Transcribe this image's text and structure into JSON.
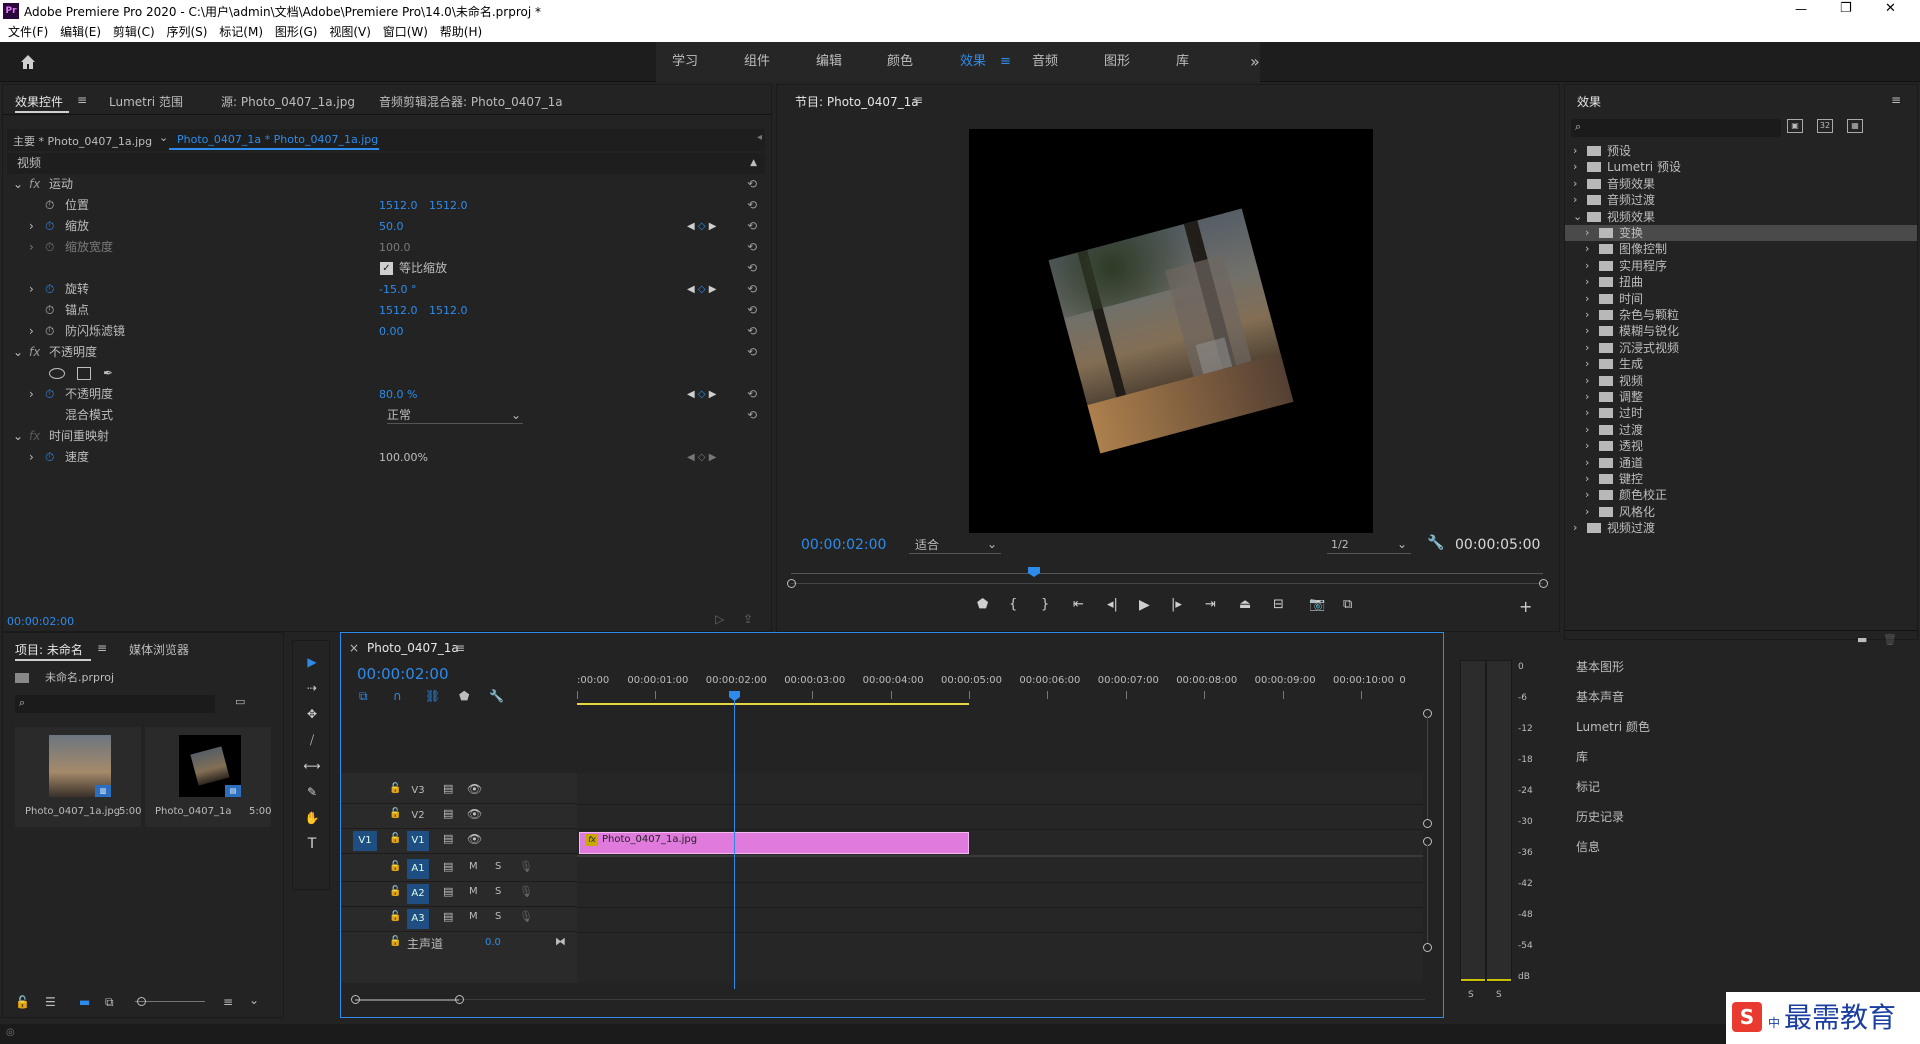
{
  "app": {
    "icon": "Pr",
    "title": "Adobe Premiere Pro 2020 - C:\\用户\\admin\\文档\\Adobe\\Premiere Pro\\14.0\\未命名.prproj *",
    "win_controls": [
      "—",
      "❐",
      "✕"
    ]
  },
  "menu": [
    "文件(F)",
    "编辑(E)",
    "剪辑(C)",
    "序列(S)",
    "标记(M)",
    "图形(G)",
    "视图(V)",
    "窗口(W)",
    "帮助(H)"
  ],
  "workspaces": {
    "items": [
      "学习",
      "组件",
      "编辑",
      "颜色",
      "效果",
      "音频",
      "图形",
      "库"
    ],
    "active": "效果",
    "menu_icon": "≡",
    "more": "»",
    "active_color": "#2d8ceb"
  },
  "effect_controls": {
    "tabs": [
      "效果控件",
      "Lumetri 范围",
      "源: Photo_0407_1a.jpg",
      "音频剪辑混合器: Photo_0407_1a"
    ],
    "tab_menu": "≡",
    "master": "主要 * Photo_0407_1a.jpg",
    "clip": "Photo_0407_1a * Photo_0407_1a.jpg",
    "section": "视频",
    "motion": "运动",
    "position_label": "位置",
    "position_x": "1512.0",
    "position_y": "1512.0",
    "scale_label": "缩放",
    "scale_value": "50.0",
    "scale_width_label": "缩放宽度",
    "scale_width_value": "100.0",
    "uniform_label": "等比缩放",
    "rotation_label": "旋转",
    "rotation_value": "-15.0 °",
    "anchor_label": "锚点",
    "anchor_x": "1512.0",
    "anchor_y": "1512.0",
    "flicker_label": "防闪烁滤镜",
    "flicker_value": "0.00",
    "opacity_group": "不透明度",
    "opacity_label": "不透明度",
    "opacity_value": "80.0 %",
    "blend_label": "混合模式",
    "blend_value": "正常",
    "time_remap": "时间重映射",
    "speed_label": "速度",
    "speed_value": "100.00%",
    "timecode": "00:00:02:00",
    "fx": "fx"
  },
  "program": {
    "title": "节目: Photo_0407_1a",
    "menu": "≡",
    "timecode": "00:00:02:00",
    "fit": "适合",
    "resolution": "1/2",
    "duration": "00:00:05:00"
  },
  "effects_panel": {
    "title": "效果",
    "menu": "≡",
    "tree": [
      {
        "label": "预设",
        "level": 0,
        "open": false
      },
      {
        "label": "Lumetri 预设",
        "level": 0,
        "open": false
      },
      {
        "label": "音频效果",
        "level": 0,
        "open": false
      },
      {
        "label": "音频过渡",
        "level": 0,
        "open": false
      },
      {
        "label": "视频效果",
        "level": 0,
        "open": true
      },
      {
        "label": "变换",
        "level": 1,
        "open": false,
        "selected": true
      },
      {
        "label": "图像控制",
        "level": 1,
        "open": false
      },
      {
        "label": "实用程序",
        "level": 1,
        "open": false
      },
      {
        "label": "扭曲",
        "level": 1,
        "open": false
      },
      {
        "label": "时间",
        "level": 1,
        "open": false
      },
      {
        "label": "杂色与颗粒",
        "level": 1,
        "open": false
      },
      {
        "label": "模糊与锐化",
        "level": 1,
        "open": false
      },
      {
        "label": "沉浸式视频",
        "level": 1,
        "open": false
      },
      {
        "label": "生成",
        "level": 1,
        "open": false
      },
      {
        "label": "视频",
        "level": 1,
        "open": false
      },
      {
        "label": "调整",
        "level": 1,
        "open": false
      },
      {
        "label": "过时",
        "level": 1,
        "open": false
      },
      {
        "label": "过渡",
        "level": 1,
        "open": false
      },
      {
        "label": "透视",
        "level": 1,
        "open": false
      },
      {
        "label": "通道",
        "level": 1,
        "open": false
      },
      {
        "label": "键控",
        "level": 1,
        "open": false
      },
      {
        "label": "颜色校正",
        "level": 1,
        "open": false
      },
      {
        "label": "风格化",
        "level": 1,
        "open": false
      },
      {
        "label": "视频过渡",
        "level": 0,
        "open": false
      }
    ],
    "collapsed_panels": [
      "基本图形",
      "基本声音",
      "Lumetri 颜色",
      "库",
      "标记",
      "历史记录",
      "信息"
    ]
  },
  "project": {
    "tabs": [
      "项目: 未命名",
      "媒体浏览器"
    ],
    "menu": "≡",
    "file": "未命名.prproj",
    "items": [
      {
        "name": "Photo_0407_1a.jpg",
        "duration": "5:00"
      },
      {
        "name": "Photo_0407_1a",
        "duration": "5:00"
      }
    ]
  },
  "tools": [
    "▶",
    "⇢",
    "✥",
    "⧸",
    "⟷",
    "✎",
    "✋",
    "T"
  ],
  "timeline": {
    "tab": "Photo_0407_1a",
    "menu": "≡",
    "close": "×",
    "timecode": "00:00:02:00",
    "ruler": [
      ":00:00",
      "00:00:01:00",
      "00:00:02:00",
      "00:00:03:00",
      "00:00:04:00",
      "00:00:05:00",
      "00:00:06:00",
      "00:00:07:00",
      "00:00:08:00",
      "00:00:09:00",
      "00:00:10:00",
      "0"
    ],
    "video_tracks": [
      "V3",
      "V2",
      "V1"
    ],
    "source_patch": "V1",
    "audio_tracks": [
      "A1",
      "A2",
      "A3"
    ],
    "master_label": "主声道",
    "master_value": "0.0",
    "clip": {
      "name": "Photo_0407_1a.jpg",
      "fx": "fx",
      "color": "#e07adc"
    },
    "m": "M",
    "s": "S"
  },
  "meter": {
    "scale": [
      "0",
      "-6",
      "-12",
      "-18",
      "-24",
      "-30",
      "-36",
      "-42",
      "-48",
      "-54",
      "dB"
    ],
    "solo": [
      "S",
      "S"
    ]
  },
  "watermark": {
    "logo": "S",
    "text": "最需教育",
    "cn": "中"
  }
}
